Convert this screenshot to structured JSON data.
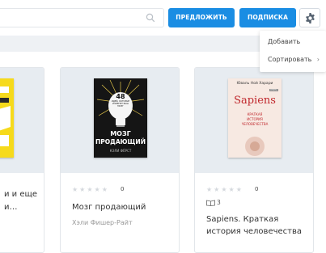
{
  "header": {
    "search_placeholder": "",
    "propose_label": "ПРЕДЛОЖИТЬ",
    "subscribe_label": "ПОДПИСКА"
  },
  "menu": {
    "items": [
      "Добавить",
      "Сортировать"
    ]
  },
  "cards": [
    {
      "title_line1": "и и еще",
      "title_line2": "и…"
    },
    {
      "cover_number": "48",
      "cover_tagline": "ИДЕЙ, КОТОРЫЕ ИЗМЕНЯТ ВАШ МОЗГ",
      "cover_title_1": "МОЗГ",
      "cover_title_2": "ПРОДАЮЩИЙ",
      "cover_author": "КЭЛИ ФЁРСТ",
      "rating": "0",
      "title": "Мозг продающий",
      "author": "Хэли Фишер-Райт"
    },
    {
      "cover_author": "Юваль Ной Харари",
      "cover_badge": "КНИГА",
      "cover_title": "Sapiens",
      "cover_sub_1": "КРАТКАЯ",
      "cover_sub_2": "ИСТОРИЯ",
      "cover_sub_3": "ЧЕЛОВЕЧЕСТВА",
      "rating": "0",
      "pages": "3",
      "title_line1": "Sapiens. Краткая",
      "title_line2": "история человечества"
    }
  ],
  "colors": {
    "accent": "#1a8de3",
    "cover_bg": "#e7ecf1",
    "strip": "#eef1f4"
  }
}
